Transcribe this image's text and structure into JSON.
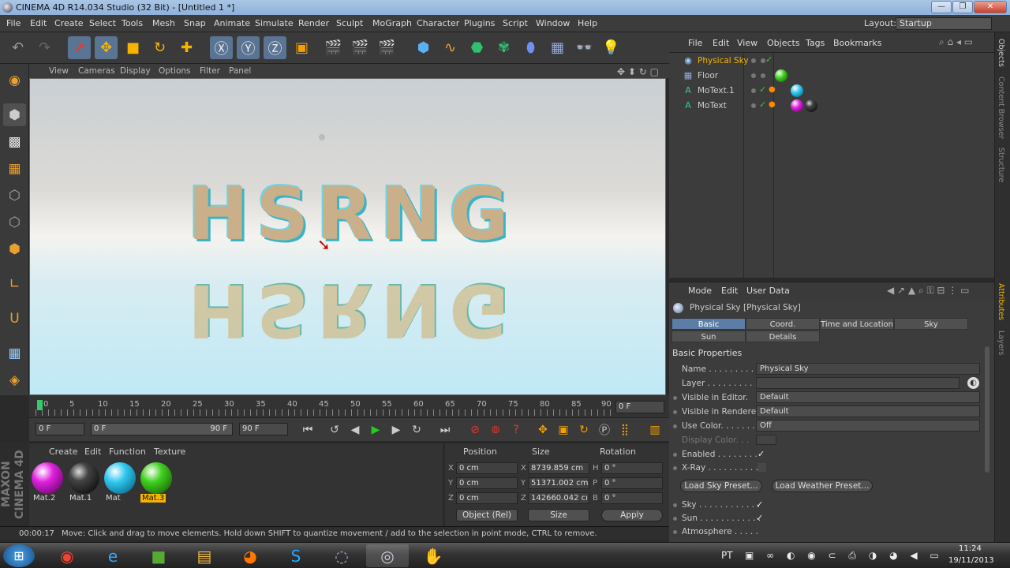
{
  "window": {
    "title": "CINEMA 4D R14.034 Studio (32 Bit) - [Untitled 1 *]",
    "controls": [
      "—",
      "❐",
      "✕"
    ]
  },
  "menubar": {
    "items": [
      "File",
      "Edit",
      "Create",
      "Select",
      "Tools",
      "Mesh",
      "Snap",
      "Animate",
      "Simulate",
      "Render",
      "Sculpt",
      "MoGraph",
      "Character",
      "Plugins",
      "Script",
      "Window",
      "Help"
    ],
    "layout_label": "Layout:",
    "layout_value": "Startup"
  },
  "viewport": {
    "menu": [
      "View",
      "Cameras",
      "Display",
      "Options",
      "Filter",
      "Panel"
    ],
    "logo_text": "HSRNG"
  },
  "timeline": {
    "ticks": [
      "0",
      "5",
      "10",
      "15",
      "20",
      "25",
      "30",
      "35",
      "40",
      "45",
      "50",
      "55",
      "60",
      "65",
      "70",
      "75",
      "80",
      "85",
      "90"
    ],
    "current_frame": "0 F",
    "start_frame": "0 F",
    "range_start": "0 F",
    "range_end": "90 F",
    "end_frame": "90 F"
  },
  "materials": {
    "menu": [
      "Create",
      "Edit",
      "Function",
      "Texture"
    ],
    "items": [
      {
        "name": "Mat.2",
        "color": "#e020e0"
      },
      {
        "name": "Mat.1",
        "color": "#222222"
      },
      {
        "name": "Mat",
        "color": "#30c8f0"
      },
      {
        "name": "Mat.3",
        "color": "#40d020"
      }
    ],
    "brand": "MAXON CINEMA 4D"
  },
  "coordinates": {
    "headers": {
      "position": "Position",
      "size": "Size",
      "rotation": "Rotation"
    },
    "rows": [
      {
        "axis": "X",
        "pos": "0 cm",
        "size_axis": "X",
        "size": "8739.859 cm",
        "rot_axis": "H",
        "rot": "0 °"
      },
      {
        "axis": "Y",
        "pos": "0 cm",
        "size_axis": "Y",
        "size": "51371.002 cm",
        "rot_axis": "P",
        "rot": "0 °"
      },
      {
        "axis": "Z",
        "pos": "0 cm",
        "size_axis": "Z",
        "size": "142660.042 cı",
        "rot_axis": "B",
        "rot": "0 °"
      }
    ],
    "mode": "Object (Rel)",
    "size_mode": "Size",
    "apply": "Apply"
  },
  "status": {
    "time": "00:00:17",
    "message": "Move: Click and drag to move elements. Hold down SHIFT to quantize movement / add to the selection in point mode, CTRL to remove."
  },
  "objects": {
    "menu": [
      "File",
      "Edit",
      "View",
      "Objects",
      "Tags",
      "Bookmarks"
    ],
    "items": [
      {
        "name": "Physical Sky",
        "icon": "sky-icon",
        "selected": true
      },
      {
        "name": "Floor",
        "icon": "floor-icon",
        "selected": false
      },
      {
        "name": "MoText.1",
        "icon": "motext-icon",
        "selected": false
      },
      {
        "name": "MoText",
        "icon": "motext-icon",
        "selected": false
      }
    ]
  },
  "side_tabs": [
    "Objects",
    "Content Browser",
    "Structure",
    "Attributes",
    "Layers"
  ],
  "attributes": {
    "menu": [
      "Mode",
      "Edit",
      "User Data"
    ],
    "object_title": "Physical Sky [Physical Sky]",
    "tabs_row1": [
      "Basic",
      "Coord.",
      "Time and Location",
      "Sky"
    ],
    "tabs_row2": [
      "Sun",
      "Details"
    ],
    "section": "Basic Properties",
    "name_label": "Name . . . . . . . . . . .",
    "name_value": "Physical Sky",
    "layer_label": "Layer . . . . . . . . . . .",
    "vis_editor_label": "Visible in Editor.",
    "vis_editor_value": "Default",
    "vis_render_label": "Visible in Renderer",
    "vis_render_value": "Default",
    "use_color_label": "Use Color. . . . . . .",
    "use_color_value": "Off",
    "display_color_label": "Display Color. . .",
    "enabled_label": "Enabled . . . . . . . .",
    "xray_label": "X-Ray . . . . . . . . . .",
    "load_sky": "Load Sky Preset...",
    "load_weather": "Load Weather Preset...",
    "sky_label": "Sky . . . . . . . . . . . .",
    "sun_label": "Sun . . . . . . . . . . . .",
    "atmosphere_label": "Atmosphere . . . . ."
  },
  "taskbar": {
    "lang": "PT",
    "time": "11:24",
    "date": "19/11/2013"
  }
}
